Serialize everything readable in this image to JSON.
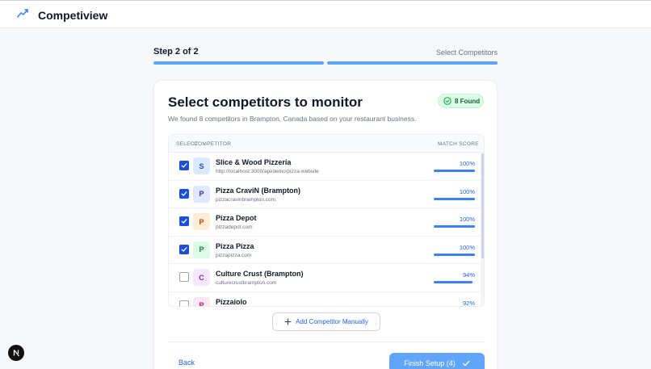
{
  "app": {
    "title": "Competiview",
    "logo_icon": "trend-line-icon"
  },
  "stepper": {
    "step_label": "Step 2 of 2",
    "step_name": "Select Competitors",
    "progress_color": "#60a5fa"
  },
  "card": {
    "title": "Select competitors to monitor",
    "subtitle": "We found 8 competitors in Brampton, Canada based on your restaurant business.",
    "found_badge": "8 Found"
  },
  "table": {
    "headers": {
      "select": "SELECT",
      "competitor": "COMPETITOR",
      "match_score": "MATCH SCORE"
    },
    "rows": [
      {
        "initial": "S",
        "name": "Slice & Wood Pizzeria",
        "url": "http://localhost:3000/api/demo/pizza-website",
        "score": "100%",
        "score_value": 100,
        "checked": true,
        "avatar_bg": "#dbeafe",
        "avatar_fg": "#1d4ed8"
      },
      {
        "initial": "P",
        "name": "Pizza CraviN (Brampton)",
        "url": "pizzacravinbrampton.com",
        "score": "100%",
        "score_value": 100,
        "checked": true,
        "avatar_bg": "#e0e7ff",
        "avatar_fg": "#3730a3"
      },
      {
        "initial": "P",
        "name": "Pizza Depot",
        "url": "pizzadepot.com",
        "score": "100%",
        "score_value": 100,
        "checked": true,
        "avatar_bg": "#ffedd5",
        "avatar_fg": "#c2410c"
      },
      {
        "initial": "P",
        "name": "Pizza Pizza",
        "url": "pizzapizza.com",
        "score": "100%",
        "score_value": 100,
        "checked": true,
        "avatar_bg": "#dcfce7",
        "avatar_fg": "#15803d"
      },
      {
        "initial": "C",
        "name": "Culture Crust (Brampton)",
        "url": "culturecrustbrampton.com",
        "score": "94%",
        "score_value": 94,
        "checked": false,
        "avatar_bg": "#f3e8ff",
        "avatar_fg": "#7e22ce"
      },
      {
        "initial": "P",
        "name": "Pizzaiolo",
        "url": "",
        "score": "92%",
        "score_value": 92,
        "checked": false,
        "avatar_bg": "#fce7f3",
        "avatar_fg": "#be185d"
      }
    ]
  },
  "actions": {
    "add_manual": "Add Competitor Manually",
    "back": "Back",
    "finish": "Finish Setup (4)"
  },
  "colors": {
    "accent": "#2563eb",
    "finish_button": "#60a5fa",
    "badge_bg": "#dcfce7"
  }
}
